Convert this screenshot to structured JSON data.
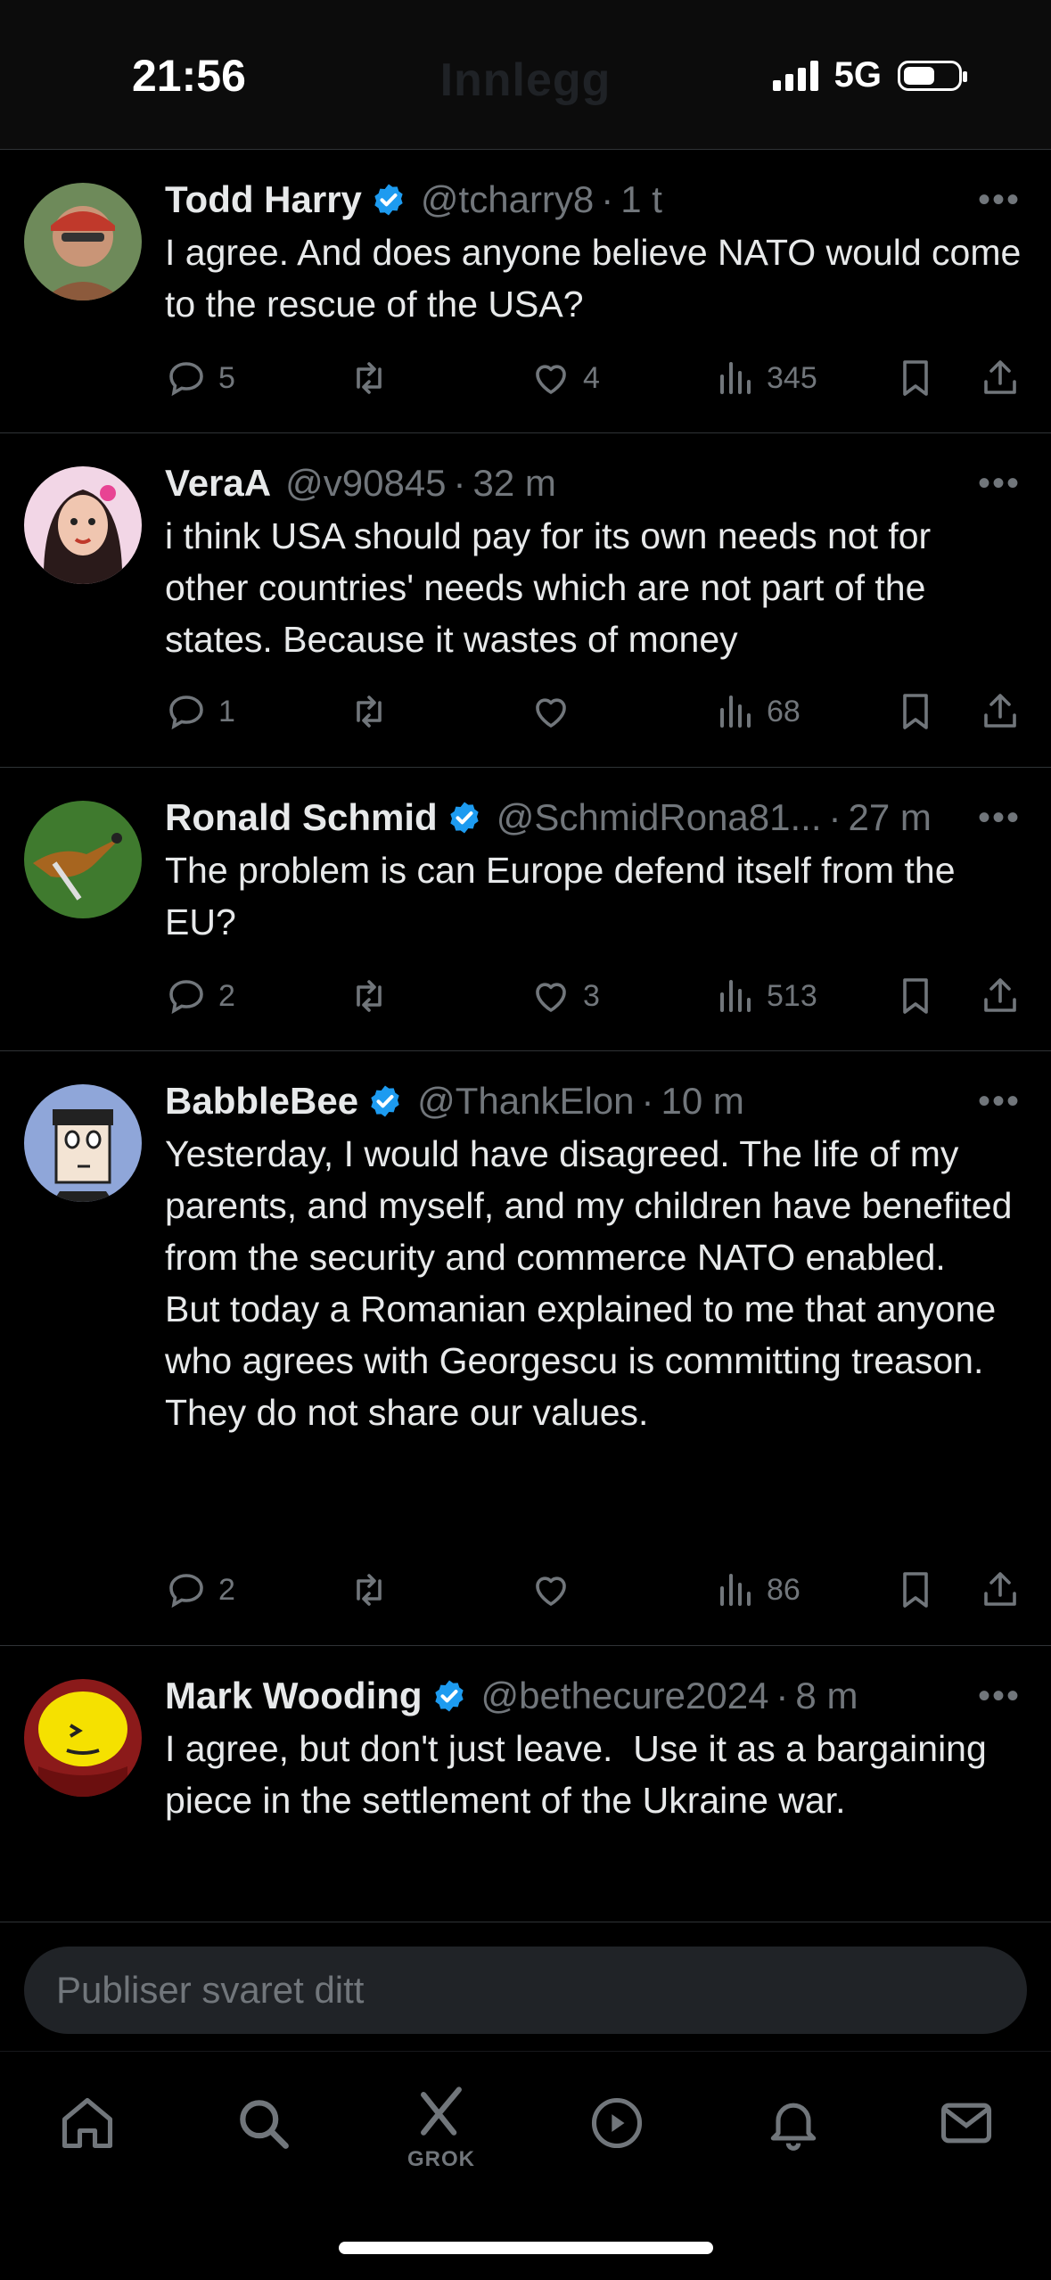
{
  "status_bar": {
    "time": "21:56",
    "network": "5G"
  },
  "header": {
    "ghost_title": "Innlegg"
  },
  "tweets": [
    {
      "name": "Todd Harry",
      "verified": true,
      "handle": "@tcharry8",
      "time": "1 t",
      "text": "I agree. And does anyone believe NATO would come to the rescue of the USA?",
      "replies": "5",
      "reposts": "",
      "likes": "4",
      "views": "345"
    },
    {
      "name": "VeraA",
      "verified": false,
      "handle": "@v90845",
      "time": "32 m",
      "text": "i think USA should pay for its own needs not for other countries' needs which are not part of the states. Because it wastes of money",
      "replies": "1",
      "reposts": "",
      "likes": "",
      "views": "68"
    },
    {
      "name": "Ronald Schmid",
      "verified": true,
      "handle": "@SchmidRona81...",
      "time": "27 m",
      "text": "The problem is can Europe defend itself from the EU?",
      "replies": "2",
      "reposts": "",
      "likes": "3",
      "views": "513"
    },
    {
      "name": "BabbleBee",
      "verified": true,
      "handle": "@ThankElon",
      "time": "10 m",
      "text": "Yesterday, I would have disagreed. The life of my parents, and myself, and my children have benefited from the security and commerce NATO enabled.\nBut today a Romanian explained to me that anyone who agrees with Georgescu is committing treason.\nThey do not share our values.",
      "replies": "2",
      "reposts": "",
      "likes": "",
      "views": "86"
    },
    {
      "name": "Mark Wooding",
      "verified": true,
      "handle": "@bethecure2024",
      "time": "8 m",
      "text": "I agree, but don't just leave.  Use it as a bargaining piece in the settlement of the Ukraine war.",
      "replies": "",
      "reposts": "",
      "likes": "",
      "views": ""
    }
  ],
  "reply_bar": {
    "placeholder": "Publiser svaret ditt"
  },
  "bottom_nav": {
    "grok_label": "GROK"
  },
  "icons": [
    "home-icon",
    "search-icon",
    "grok-icon",
    "video-icon",
    "notifications-icon",
    "messages-icon",
    "reply-icon",
    "repost-icon",
    "like-icon",
    "views-icon",
    "bookmark-icon",
    "share-icon",
    "verified-icon",
    "more-icon"
  ],
  "colors": {
    "background": "#000000",
    "text": "#e7e9ea",
    "muted": "#71767b",
    "verified": "#1d9bf0",
    "divider": "#2f3336"
  }
}
